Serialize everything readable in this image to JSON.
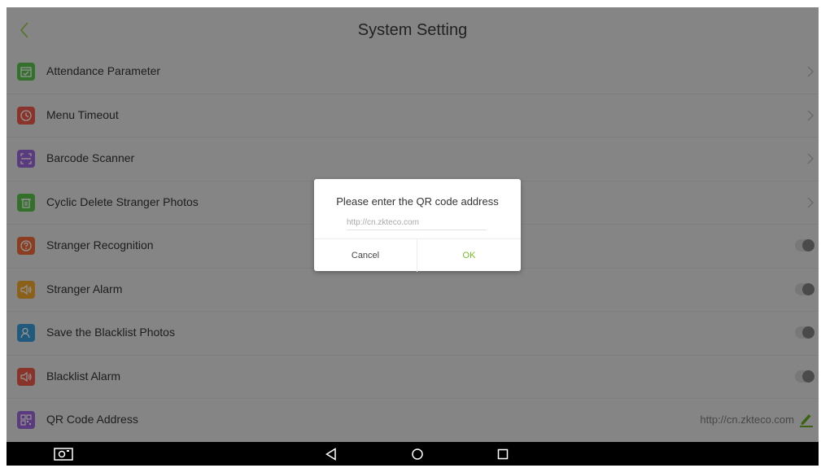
{
  "header": {
    "title": "System Setting"
  },
  "settings": [
    {
      "label": "Attendance Parameter",
      "icon": "calendar-check-icon",
      "color": "#5bbf4c",
      "control": "chevron"
    },
    {
      "label": "Menu Timeout",
      "icon": "clock-icon",
      "color": "#ec5a4a",
      "control": "chevron"
    },
    {
      "label": "Barcode Scanner",
      "icon": "scan-frame-icon",
      "color": "#9b67d8",
      "control": "chevron"
    },
    {
      "label": "Cyclic Delete Stranger Photos",
      "icon": "trash-icon",
      "color": "#5bbf4c",
      "control": "chevron"
    },
    {
      "label": "Stranger Recognition",
      "icon": "question-circle-icon",
      "color": "#f06a3c",
      "control": "toggle",
      "toggle_on": false
    },
    {
      "label": "Stranger Alarm",
      "icon": "speaker-icon",
      "color": "#f0a530",
      "control": "toggle",
      "toggle_on": false
    },
    {
      "label": "Save the Blacklist Photos",
      "icon": "person-icon",
      "color": "#3a9bd8",
      "control": "toggle",
      "toggle_on": false
    },
    {
      "label": "Blacklist Alarm",
      "icon": "speaker-icon",
      "color": "#ec5a4a",
      "control": "toggle",
      "toggle_on": false
    },
    {
      "label": "QR Code Address",
      "icon": "qr-code-icon",
      "color": "#9b67d8",
      "control": "value",
      "value": "http://cn.zkteco.com"
    }
  ],
  "dialog": {
    "title": "Please enter the QR code address",
    "input_placeholder": "http://cn.zkteco.com",
    "input_value": "",
    "cancel_label": "Cancel",
    "ok_label": "OK"
  },
  "colors": {
    "accent": "#7ab82a",
    "edit_icon": "#6aa820"
  },
  "navbar": {
    "icons": [
      "camera-icon",
      "back-triangle-icon",
      "home-circle-icon",
      "recents-square-icon"
    ]
  }
}
